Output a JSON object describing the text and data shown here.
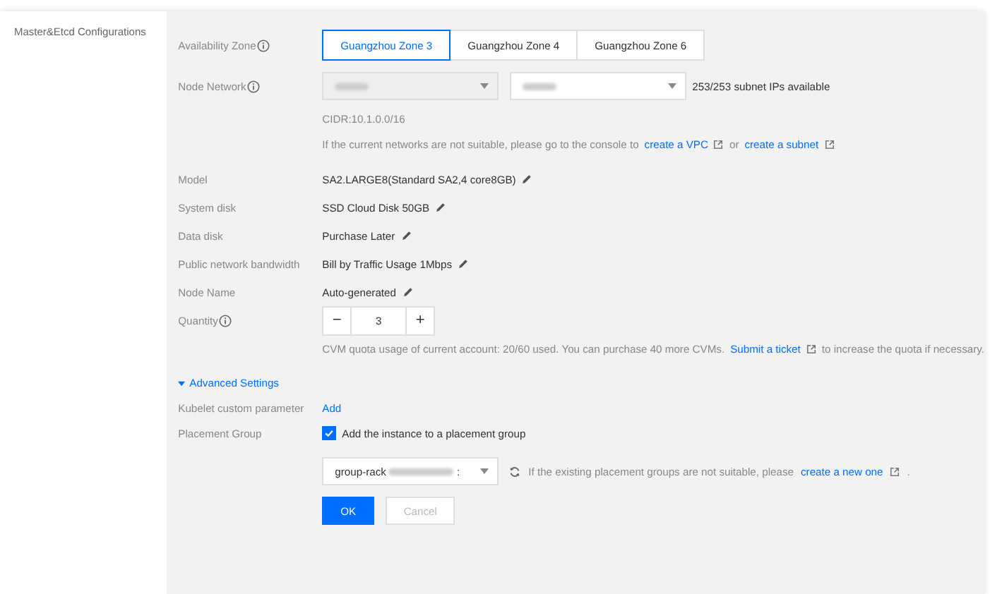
{
  "sidebar": {
    "title": "Master&Etcd Configurations"
  },
  "availability_zone": {
    "label": "Availability Zone",
    "tabs": [
      {
        "label": "Guangzhou Zone 3",
        "selected": true
      },
      {
        "label": "Guangzhou Zone 4",
        "selected": false
      },
      {
        "label": "Guangzhou Zone 6",
        "selected": false
      }
    ]
  },
  "node_network": {
    "label": "Node Network",
    "subnet_info": "253/253 subnet IPs available",
    "cidr": "CIDR:10.1.0.0/16",
    "help": "If the current networks are not suitable, please go to the console to",
    "link_1": "create a VPC",
    "middle": "or",
    "link_2": "create a subnet"
  },
  "specs": [
    {
      "label": "Model",
      "value": "SA2.LARGE8(Standard SA2,4 core8GB)"
    },
    {
      "label": "System disk",
      "value": "SSD Cloud Disk 50GB"
    },
    {
      "label": "Data disk",
      "value": "Purchase Later"
    },
    {
      "label": "Public network bandwidth",
      "value": "Bill by Traffic Usage 1Mbps"
    },
    {
      "label": "Node Name",
      "value": "Auto-generated"
    }
  ],
  "quantity": {
    "label": "Quantity",
    "minus": "−",
    "value": "3",
    "plus": "+",
    "note": "CVM quota usage of current account: 20/60 used. You can purchase 40 more CVMs.",
    "link": "Submit a ticket",
    "note_end": "to increase the quota if necessary."
  },
  "advanced": {
    "label": "Advanced Settings",
    "expanded": true
  },
  "kubelet": {
    "label": "Kubelet custom parameter",
    "action": "Add"
  },
  "placement": {
    "label": "Placement Group",
    "checkbox": {
      "label": "Add the instance to a placement group",
      "checked": true
    },
    "group_value": "group-rack",
    "group_value_end": ":",
    "help": "If the existing placement groups are not suitable, please",
    "link": "create a new one",
    "end": "."
  },
  "buttons": [
    {
      "label": "OK",
      "kind": "primary"
    },
    {
      "label": "Cancel",
      "kind": "secondary"
    }
  ]
}
